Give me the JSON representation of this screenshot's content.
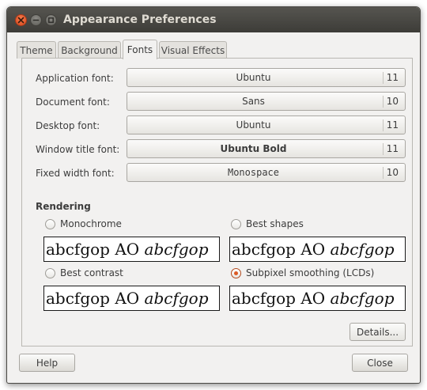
{
  "window": {
    "title": "Appearance Preferences",
    "controls": [
      "close-icon",
      "minimize-icon",
      "maximize-icon"
    ]
  },
  "tabs": [
    {
      "label": "Theme",
      "active": false
    },
    {
      "label": "Background",
      "active": false
    },
    {
      "label": "Fonts",
      "active": true
    },
    {
      "label": "Visual Effects",
      "active": false
    }
  ],
  "fonts": [
    {
      "label": "Application font:",
      "font": "Ubuntu",
      "size": "11"
    },
    {
      "label": "Document font:",
      "font": "Sans",
      "size": "10"
    },
    {
      "label": "Desktop font:",
      "font": "Ubuntu",
      "size": "11"
    },
    {
      "label": "Window title font:",
      "font": "Ubuntu Bold",
      "size": "11"
    },
    {
      "label": "Fixed width font:",
      "font": "Monospace",
      "size": "10"
    }
  ],
  "rendering": {
    "title": "Rendering",
    "options": [
      {
        "label": "Monochrome",
        "selected": false,
        "preview_regular": "abcfgop AO ",
        "preview_italic": "abcfgop"
      },
      {
        "label": "Best shapes",
        "selected": false,
        "preview_regular": "abcfgop AO ",
        "preview_italic": "abcfgop"
      },
      {
        "label": "Best contrast",
        "selected": false,
        "preview_regular": "abcfgop AO ",
        "preview_italic": "abcfgop"
      },
      {
        "label": "Subpixel smoothing (LCDs)",
        "selected": true,
        "preview_regular": "abcfgop AO ",
        "preview_italic": "abcfgop"
      }
    ]
  },
  "buttons": {
    "details": "Details...",
    "help": "Help",
    "close": "Close"
  },
  "colors": {
    "titlebar": "#3d3c38",
    "close_button": "#df4e20",
    "radio_accent": "#dd5a25",
    "window_bg": "#f2f1f0"
  }
}
